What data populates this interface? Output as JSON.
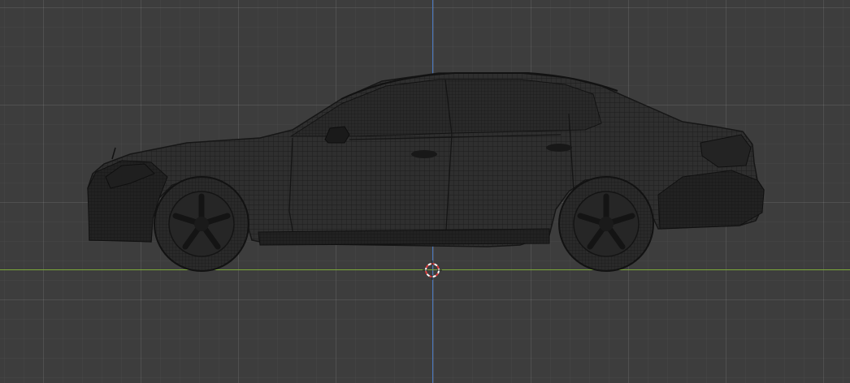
{
  "viewport": {
    "background_color": "#3d3d3d",
    "grid_color": "#4a4a4a",
    "axis_z_color": "#4a78c0",
    "axis_y_color": "#7ca83a",
    "shading_mode": "wireframe",
    "view": "side-orthographic"
  },
  "scene": {
    "object_icon": "car-wireframe-icon",
    "wire_color": "#1c1c1c",
    "body_color": "#2e2e2e"
  },
  "cursor": {
    "icon": "3d-cursor-icon",
    "ring_color_a": "#e04040",
    "ring_color_b": "#ffffff"
  }
}
